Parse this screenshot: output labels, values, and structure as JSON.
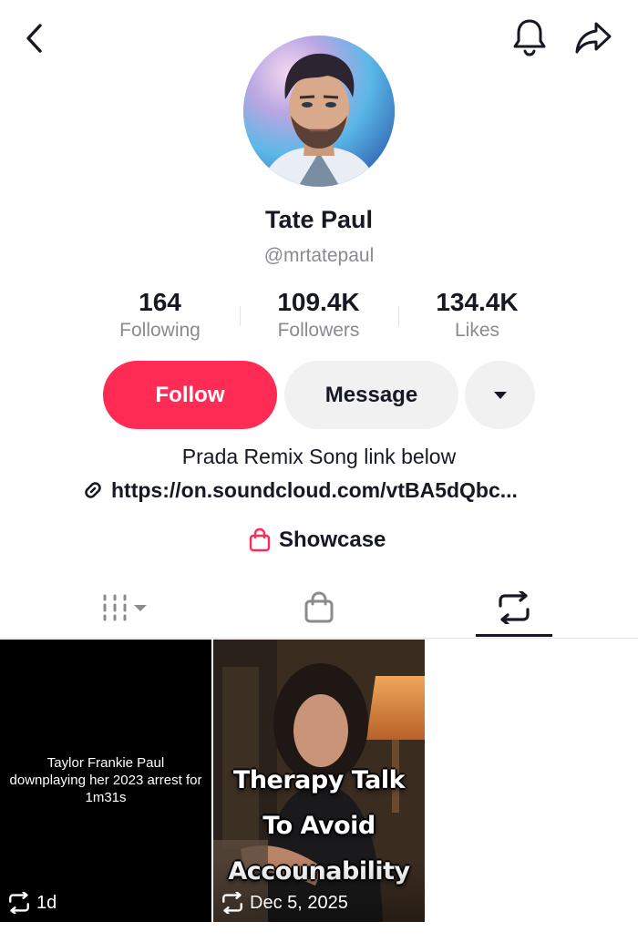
{
  "profile": {
    "name": "Tate Paul",
    "handle": "@mrtatepaul",
    "bio": "Prada Remix Song link below",
    "link": "https://on.soundcloud.com/vtBA5dQbc..."
  },
  "stats": {
    "following": {
      "value": "164",
      "label": "Following"
    },
    "followers": {
      "value": "109.4K",
      "label": "Followers"
    },
    "likes": {
      "value": "134.4K",
      "label": "Likes"
    }
  },
  "actions": {
    "follow_label": "Follow",
    "message_label": "Message"
  },
  "showcase_label": "Showcase",
  "tabs": [
    {
      "id": "videos",
      "icon": "grid-icon"
    },
    {
      "id": "shop",
      "icon": "shopping-bag-icon"
    },
    {
      "id": "reposts",
      "icon": "repost-icon",
      "active": true
    }
  ],
  "grid": [
    {
      "caption": "Taylor Frankie Paul downplaying her 2023 arrest for 1m31s",
      "meta": "1d"
    },
    {
      "overlay_lines": [
        "Therapy Talk",
        "To Avoid",
        "Accounability"
      ],
      "meta": "Dec 5, 2025"
    }
  ],
  "colors": {
    "accent": "#fe2c55",
    "text": "#161823",
    "muted": "#8a8b91",
    "button_secondary": "#f1f1f2"
  },
  "icons": {
    "back": "chevron-left-icon",
    "notifications": "bell-icon",
    "share": "share-arrow-icon",
    "more": "caret-down-icon",
    "link": "link-icon",
    "showcase": "shopping-bag-icon"
  }
}
